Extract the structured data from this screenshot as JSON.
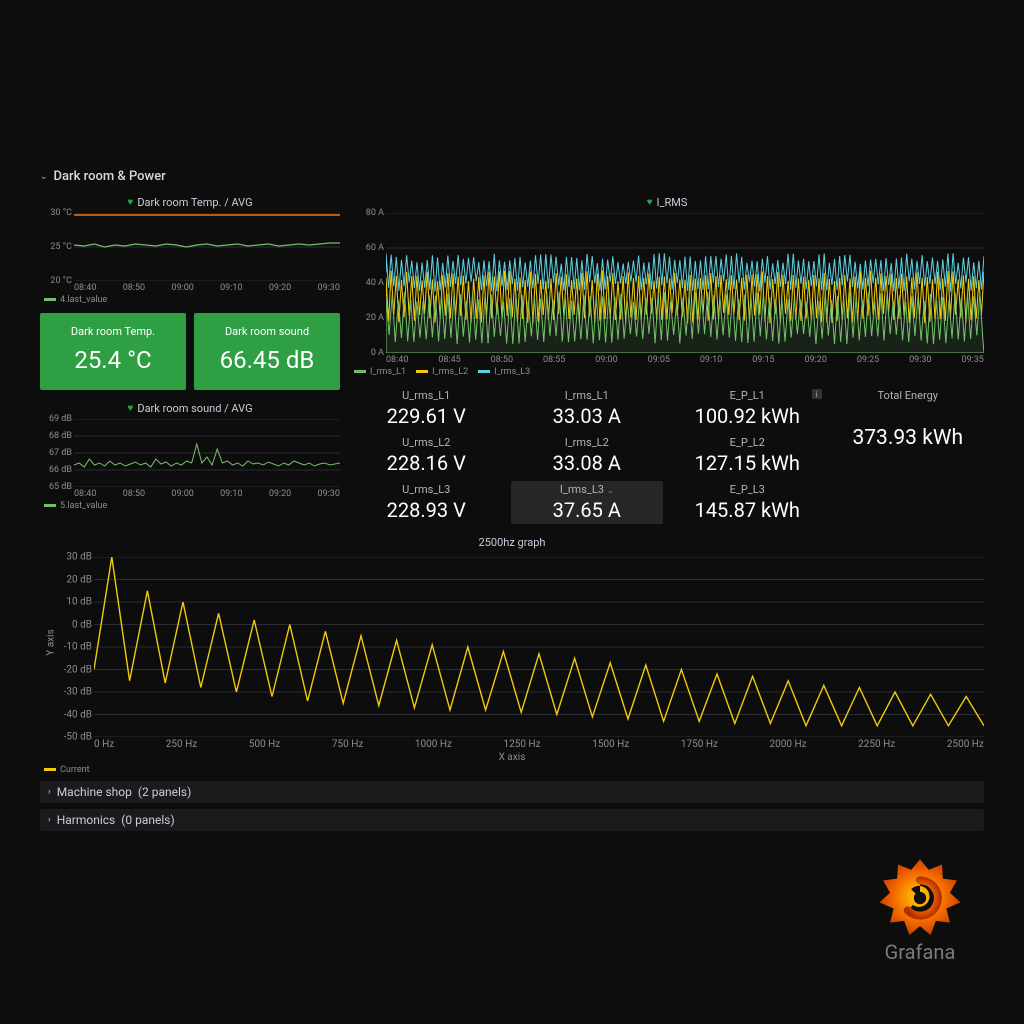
{
  "rows": {
    "main": {
      "title": "Dark room & Power",
      "expanded": true
    },
    "machine": {
      "title": "Machine shop",
      "meta": "(2 panels)",
      "expanded": false
    },
    "harmonics": {
      "title": "Harmonics",
      "meta": "(0 panels)",
      "expanded": false
    }
  },
  "temp_chart": {
    "title": "Dark room Temp. / AVG",
    "legend": "4.last_value",
    "y_ticks": [
      "30 °C",
      "25 °C",
      "20 °C"
    ],
    "x_ticks": [
      "08:40",
      "08:50",
      "09:00",
      "09:10",
      "09:20",
      "09:30"
    ],
    "threshold_color": "#eb7b18"
  },
  "sound_chart": {
    "title": "Dark room sound / AVG",
    "legend": "5.last_value",
    "y_ticks": [
      "69 dB",
      "68 dB",
      "67 dB",
      "66 dB",
      "65 dB"
    ],
    "x_ticks": [
      "08:40",
      "08:50",
      "09:00",
      "09:10",
      "09:20",
      "09:30"
    ]
  },
  "stat_temp": {
    "label": "Dark room Temp.",
    "value": "25.4 °C"
  },
  "stat_sound": {
    "label": "Dark room sound",
    "value": "66.45 dB"
  },
  "irms": {
    "title": "I_RMS",
    "legend": [
      "I_rms_L1",
      "I_rms_L2",
      "I_rms_L3"
    ],
    "colors": [
      "#73bf69",
      "#f2cc0c",
      "#5cd0e0"
    ],
    "y_ticks": [
      "80 A",
      "60 A",
      "40 A",
      "20 A",
      "0 A"
    ],
    "x_ticks": [
      "08:40",
      "08:45",
      "08:50",
      "08:55",
      "09:00",
      "09:05",
      "09:10",
      "09:15",
      "09:20",
      "09:25",
      "09:30",
      "09:35"
    ]
  },
  "metrics": {
    "u_l1": {
      "label": "U_rms_L1",
      "value": "229.61 V"
    },
    "u_l2": {
      "label": "U_rms_L2",
      "value": "228.16 V"
    },
    "u_l3": {
      "label": "U_rms_L3",
      "value": "228.93 V"
    },
    "i_l1": {
      "label": "I_rms_L1",
      "value": "33.03 A"
    },
    "i_l2": {
      "label": "I_rms_L2",
      "value": "33.08 A"
    },
    "i_l3": {
      "label": "I_rms_L3",
      "value": "37.65 A"
    },
    "e_l1": {
      "label": "E_P_L1",
      "value": "100.92 kWh"
    },
    "e_l2": {
      "label": "E_P_L2",
      "value": "127.15 kWh"
    },
    "e_l3": {
      "label": "E_P_L3",
      "value": "145.87 kWh"
    },
    "total": {
      "label": "Total Energy",
      "value": "373.93 kWh"
    }
  },
  "hz": {
    "title": "2500hz graph",
    "ylabel": "Y axis",
    "xlabel": "X axis",
    "legend": "Current",
    "y_ticks": [
      "30 dB",
      "20 dB",
      "10 dB",
      "0 dB",
      "-10 dB",
      "-20 dB",
      "-30 dB",
      "-40 dB",
      "-50 dB"
    ],
    "x_ticks": [
      "0 Hz",
      "250 Hz",
      "500 Hz",
      "750 Hz",
      "1000 Hz",
      "1250 Hz",
      "1500 Hz",
      "1750 Hz",
      "2000 Hz",
      "2250 Hz",
      "2500 Hz"
    ]
  },
  "brand": "Grafana",
  "chart_data": [
    {
      "id": "temp_avg",
      "type": "line",
      "title": "Dark room Temp. / AVG",
      "x": [
        "08:40",
        "08:50",
        "09:00",
        "09:10",
        "09:20",
        "09:30"
      ],
      "series": [
        {
          "name": "4.last_value",
          "values": [
            25.4,
            25.3,
            25.5,
            25.4,
            25.3,
            25.5
          ]
        }
      ],
      "ylim": [
        20,
        30
      ],
      "threshold": 30,
      "ylabel": "°C"
    },
    {
      "id": "sound_avg",
      "type": "line",
      "title": "Dark room sound / AVG",
      "x": [
        "08:40",
        "08:50",
        "09:00",
        "09:10",
        "09:20",
        "09:30"
      ],
      "series": [
        {
          "name": "5.last_value",
          "values": [
            66.4,
            66.5,
            67.2,
            66.7,
            66.5,
            66.4
          ]
        }
      ],
      "ylim": [
        65,
        69
      ],
      "ylabel": "dB"
    },
    {
      "id": "irms",
      "type": "line",
      "title": "I_RMS",
      "x": [
        "08:40",
        "08:45",
        "08:50",
        "08:55",
        "09:00",
        "09:05",
        "09:10",
        "09:15",
        "09:20",
        "09:25",
        "09:30",
        "09:35"
      ],
      "series": [
        {
          "name": "I_rms_L1",
          "values": [
            42,
            18,
            40,
            20,
            38,
            22,
            40,
            18,
            35,
            30,
            20,
            22
          ]
        },
        {
          "name": "I_rms_L2",
          "values": [
            35,
            32,
            40,
            30,
            42,
            28,
            40,
            30,
            36,
            20,
            32,
            30
          ]
        },
        {
          "name": "I_rms_L3",
          "values": [
            50,
            48,
            52,
            46,
            50,
            48,
            52,
            46,
            48,
            44,
            48,
            50
          ]
        }
      ],
      "ylim": [
        0,
        80
      ],
      "ylabel": "A"
    },
    {
      "id": "2500hz",
      "type": "line",
      "title": "2500hz graph",
      "xlabel": "X axis",
      "ylabel": "Y axis",
      "x_hz": [
        0,
        50,
        100,
        150,
        200,
        250,
        300,
        350,
        400,
        450,
        500,
        550,
        600,
        650,
        700,
        750,
        800,
        850,
        900,
        950,
        1000,
        1050,
        1100,
        1150,
        1200,
        1250,
        1300,
        1350,
        1400,
        1450,
        1500,
        1550,
        1600,
        1650,
        1700,
        1750,
        1800,
        1850,
        1900,
        1950,
        2000,
        2050,
        2100,
        2150,
        2200,
        2250,
        2300,
        2350,
        2400,
        2450,
        2500
      ],
      "series": [
        {
          "name": "Current",
          "values": [
            -20,
            30,
            -25,
            15,
            -26,
            10,
            -28,
            5,
            -30,
            2,
            -32,
            0,
            -34,
            -3,
            -35,
            -5,
            -36,
            -7,
            -37,
            -9,
            -38,
            -10,
            -38,
            -12,
            -39,
            -13,
            -40,
            -15,
            -41,
            -17,
            -42,
            -18,
            -43,
            -20,
            -43,
            -22,
            -44,
            -23,
            -44,
            -25,
            -45,
            -27,
            -45,
            -28,
            -45,
            -30,
            -45,
            -31,
            -45,
            -32,
            -45
          ]
        }
      ],
      "ylim": [
        -50,
        30
      ],
      "xlim": [
        0,
        2500
      ]
    }
  ]
}
